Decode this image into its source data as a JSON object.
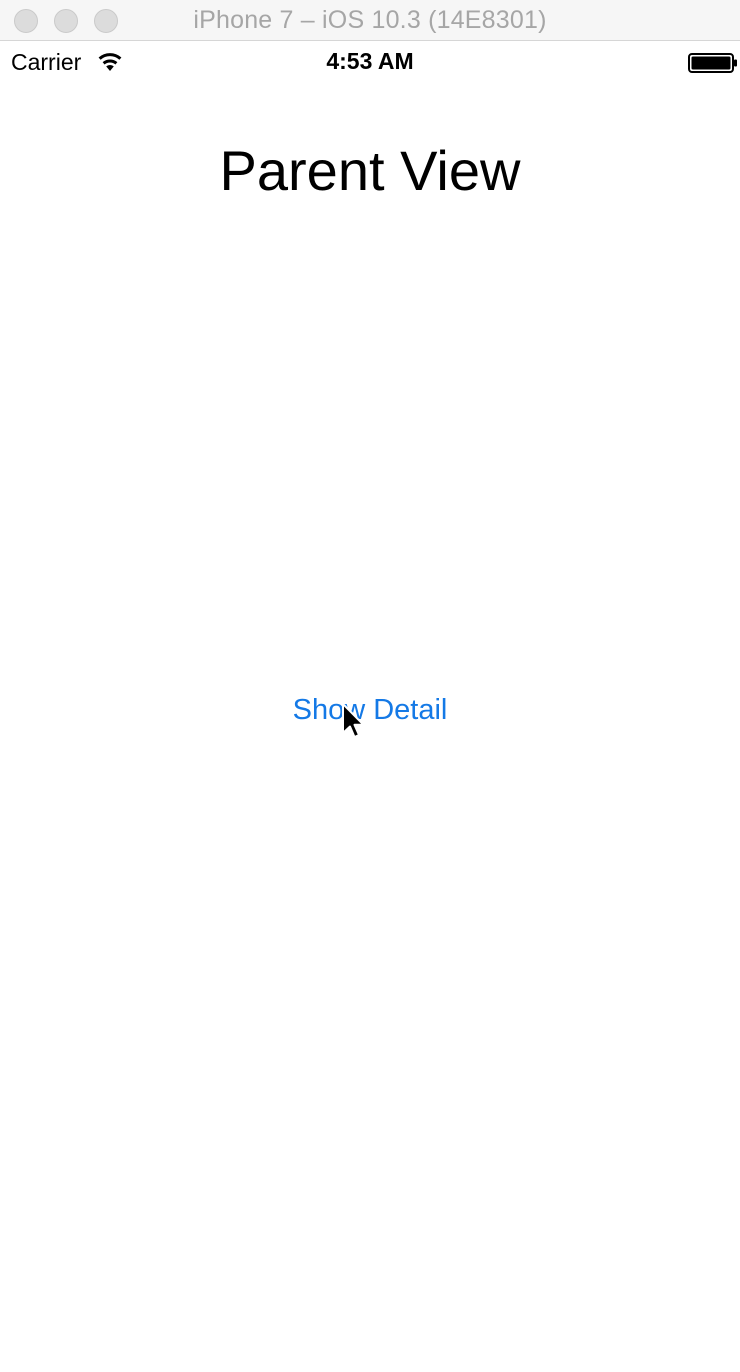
{
  "window": {
    "title": "iPhone 7 – iOS 10.3 (14E8301)",
    "controls": [
      "close-button",
      "minimize-button",
      "zoom-button"
    ]
  },
  "status_bar": {
    "carrier": "Carrier",
    "time": "4:53 AM",
    "icons": [
      "wifi-icon",
      "battery-icon"
    ]
  },
  "main": {
    "title": "Parent View",
    "show_detail_label": "Show Detail"
  },
  "colors": {
    "accent": "#1479e6",
    "title_text": "#000000",
    "window_title_text": "#a6a6a6"
  }
}
